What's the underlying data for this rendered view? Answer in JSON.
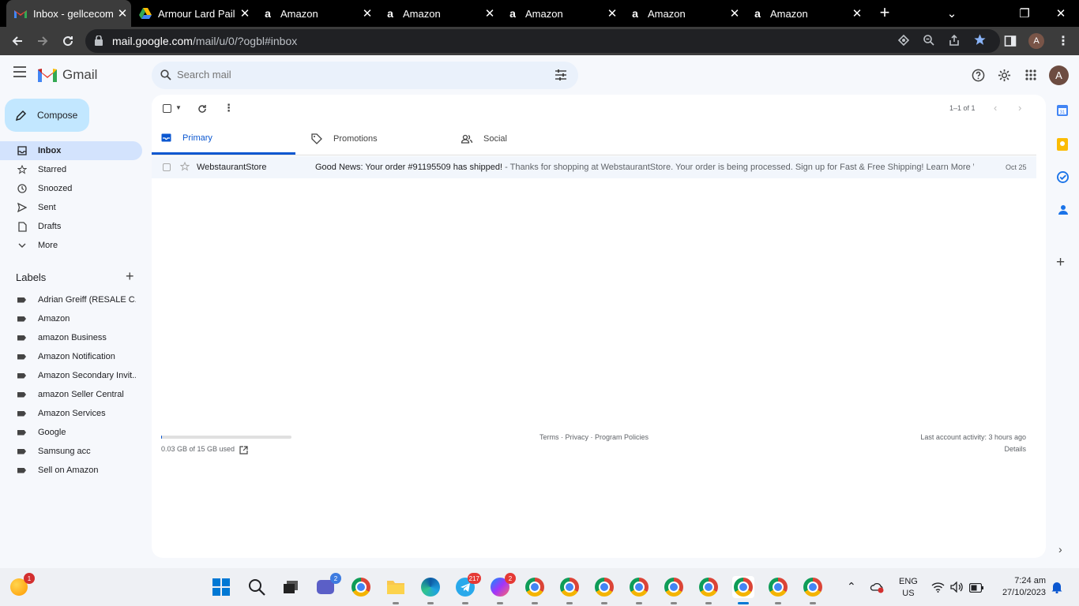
{
  "browser": {
    "tabs": [
      {
        "title": "Inbox - gellcecom",
        "icon": "gmail-icon",
        "active": true
      },
      {
        "title": "Armour Lard Pail",
        "icon": "drive-icon",
        "active": false
      },
      {
        "title": "Amazon",
        "icon": "amazon-icon",
        "active": false
      },
      {
        "title": "Amazon",
        "icon": "amazon-icon",
        "active": false
      },
      {
        "title": "Amazon",
        "icon": "amazon-icon",
        "active": false
      },
      {
        "title": "Amazon",
        "icon": "amazon-icon",
        "active": false
      },
      {
        "title": "Amazon",
        "icon": "amazon-icon",
        "active": false
      }
    ],
    "url_host": "mail.google.com",
    "url_path": "/mail/u/0/?ogbl#inbox",
    "profile_initial": "A"
  },
  "gmail": {
    "logo_text": "Gmail",
    "search_placeholder": "Search mail",
    "compose_label": "Compose",
    "avatar_initial": "A",
    "nav": [
      {
        "label": "Inbox",
        "icon": "inbox-icon",
        "active": true
      },
      {
        "label": "Starred",
        "icon": "star-icon"
      },
      {
        "label": "Snoozed",
        "icon": "clock-icon"
      },
      {
        "label": "Sent",
        "icon": "send-icon"
      },
      {
        "label": "Drafts",
        "icon": "draft-icon"
      },
      {
        "label": "More",
        "icon": "chevron-down-icon"
      }
    ],
    "labels_heading": "Labels",
    "labels": [
      "Adrian Greiff (RESALE C...",
      "Amazon",
      "amazon Business",
      "Amazon Notification",
      "Amazon Secondary Invit...",
      "amazon Seller Central",
      "Amazon Services",
      "Google",
      "Samsung acc",
      "Sell on Amazon"
    ],
    "pagination": "1–1 of 1",
    "tabs": [
      {
        "label": "Primary",
        "icon": "inbox-tab-icon",
        "active": true
      },
      {
        "label": "Promotions",
        "icon": "tag-icon"
      },
      {
        "label": "Social",
        "icon": "people-icon"
      }
    ],
    "emails": [
      {
        "sender": "WebstaurantStore",
        "subject": "Good News: Your order #91195509 has shipped!",
        "snippet": " - Thanks for shopping at WebstaurantStore. Your order is being processed. Sign up for Fast & Free Shipping! Learn More Web...",
        "date": "Oct 25"
      }
    ],
    "storage_text": "0.03 GB of 15 GB used",
    "storage_fraction": 0.002,
    "footer_links": "Terms · Privacy · Program Policies",
    "last_activity": "Last account activity: 3 hours ago",
    "details_link": "Details"
  },
  "taskbar": {
    "lang_top": "ENG",
    "lang_bottom": "US",
    "time": "7:24 am",
    "date": "27/10/2023",
    "badges": {
      "weather": "1",
      "meet": "2",
      "telegram": "217",
      "messenger": "2"
    }
  },
  "colors": {
    "gmail_red": "#ea4335",
    "accent_blue": "#0b57d0",
    "nav_active": "#d3e3fd",
    "compose_bg": "#c2e7ff"
  }
}
